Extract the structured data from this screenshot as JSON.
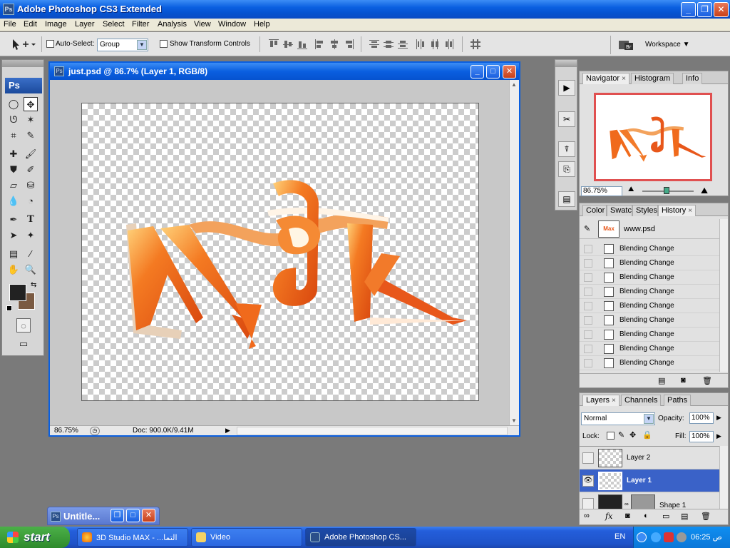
{
  "app": {
    "title": "Adobe Photoshop CS3 Extended",
    "badge": "Ps"
  },
  "menu": [
    "File",
    "Edit",
    "Image",
    "Layer",
    "Select",
    "Filter",
    "Analysis",
    "View",
    "Window",
    "Help"
  ],
  "options": {
    "auto_select_label": "Auto-Select:",
    "auto_select_value": "Group",
    "show_transform_label": "Show Transform Controls",
    "workspace_label": "Workspace"
  },
  "toolbox": {
    "logo": "Ps"
  },
  "document": {
    "title": "just.psd @ 86.7% (Layer 1, RGB/8)",
    "zoom": "86.75%",
    "doc_info": "Doc: 900.0K/9.41M",
    "artwork_text": "Max"
  },
  "navigator": {
    "tabs": [
      "Navigator",
      "Histogram",
      "Info"
    ],
    "zoom": "86.75%"
  },
  "history": {
    "tabs": [
      "Color",
      "Swatches",
      "Styles",
      "History"
    ],
    "snapshot": "www.psd",
    "items": [
      "Blending Change",
      "Blending Change",
      "Blending Change",
      "Blending Change",
      "Blending Change",
      "Blending Change",
      "Blending Change",
      "Blending Change",
      "Blending Change"
    ]
  },
  "layers": {
    "tabs": [
      "Layers",
      "Channels",
      "Paths"
    ],
    "blend_mode": "Normal",
    "opacity_label": "Opacity:",
    "opacity": "100%",
    "lock_label": "Lock:",
    "fill_label": "Fill:",
    "fill": "100%",
    "items": [
      "Layer 2",
      "Layer 1",
      "Shape 1"
    ]
  },
  "minimized_doc": {
    "title": "Untitle..."
  },
  "taskbar": {
    "start": "start",
    "items": [
      "3D Studio MAX - ...التما",
      "Video",
      "Adobe Photoshop CS..."
    ],
    "lang": "EN",
    "clock": "06:25 ص"
  },
  "colors": {
    "xp_blue": "#0a5fe0",
    "artwork_orange": "#f06a1c",
    "selected_layer": "#3a62c8"
  }
}
